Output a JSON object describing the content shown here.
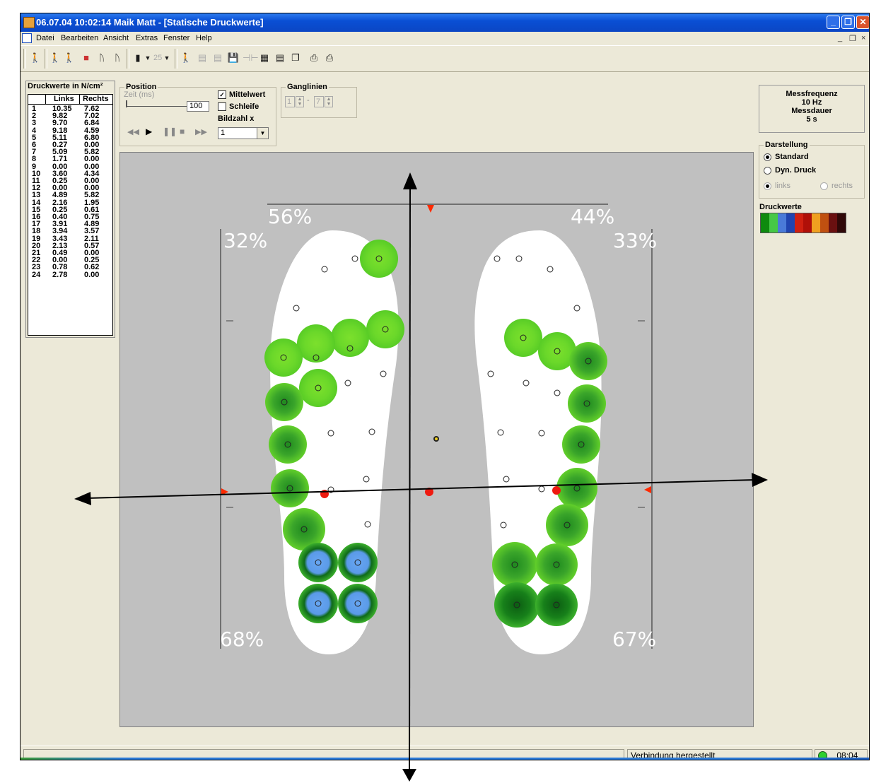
{
  "window": {
    "title": "06.07.04 10:02:14 Maik Matt  - [Statische Druckwerte]",
    "buttons": {
      "minimize": "_",
      "restore": "❐",
      "close": "✕"
    }
  },
  "menu": {
    "items": [
      "Datei",
      "Bearbeiten",
      "Ansicht",
      "Extras",
      "Fenster",
      "Help"
    ],
    "mdi_buttons": [
      "_",
      "❐",
      "×"
    ]
  },
  "toolbar": {
    "zoom_value": "25"
  },
  "pressure_table": {
    "title": "Druckwerte in N/cm²",
    "col_left": "Links",
    "col_right": "Rechts",
    "rows": [
      {
        "n": "1",
        "l": "10.35",
        "r": "7.62"
      },
      {
        "n": "2",
        "l": "9.82",
        "r": "7.02"
      },
      {
        "n": "3",
        "l": "9.70",
        "r": "6.84"
      },
      {
        "n": "4",
        "l": "9.18",
        "r": "4.59"
      },
      {
        "n": "5",
        "l": "5.11",
        "r": "6.80"
      },
      {
        "n": "6",
        "l": "0.27",
        "r": "0.00"
      },
      {
        "n": "7",
        "l": "5.09",
        "r": "5.82"
      },
      {
        "n": "8",
        "l": "1.71",
        "r": "0.00"
      },
      {
        "n": "9",
        "l": "0.00",
        "r": "0.00"
      },
      {
        "n": "10",
        "l": "3.60",
        "r": "4.34"
      },
      {
        "n": "11",
        "l": "0.25",
        "r": "0.00"
      },
      {
        "n": "12",
        "l": "0.00",
        "r": "0.00"
      },
      {
        "n": "13",
        "l": "4.89",
        "r": "5.82"
      },
      {
        "n": "14",
        "l": "2.16",
        "r": "1.95"
      },
      {
        "n": "15",
        "l": "0.25",
        "r": "0.61"
      },
      {
        "n": "16",
        "l": "0.40",
        "r": "0.75"
      },
      {
        "n": "17",
        "l": "3.91",
        "r": "4.89"
      },
      {
        "n": "18",
        "l": "3.94",
        "r": "3.57"
      },
      {
        "n": "19",
        "l": "3.43",
        "r": "2.11"
      },
      {
        "n": "20",
        "l": "2.13",
        "r": "0.57"
      },
      {
        "n": "21",
        "l": "0.49",
        "r": "0.00"
      },
      {
        "n": "22",
        "l": "0.00",
        "r": "0.25"
      },
      {
        "n": "23",
        "l": "0.78",
        "r": "0.62"
      },
      {
        "n": "24",
        "l": "2.78",
        "r": "0.00"
      }
    ]
  },
  "position": {
    "title": "Position",
    "zeit_label": "Zeit (ms)",
    "zeit_value": "100",
    "mittelwert_label": "Mittelwert",
    "mittelwert_checked": true,
    "schleife_label": "Schleife",
    "schleife_checked": false,
    "bildzahl_label": "Bildzahl x",
    "bildzahl_value": "1"
  },
  "ganglinien": {
    "title": "Ganglinien",
    "from": "1",
    "to": "7",
    "dash": "-"
  },
  "measurement": {
    "freq_label": "Messfrequenz",
    "freq_value": "10 Hz",
    "dur_label": "Messdauer",
    "dur_value": "5 s"
  },
  "darstellung": {
    "title": "Darstellung",
    "options": [
      "Standard",
      "Dyn. Druck"
    ],
    "selected": "Standard",
    "side_options": [
      "links",
      "rechts"
    ]
  },
  "legend": {
    "title": "Druckwerte",
    "colors": [
      "#0e8a0e",
      "#46c846",
      "#4a7ad8",
      "#2044b0",
      "#d02010",
      "#b01008",
      "#f0a020",
      "#c05010",
      "#6a1010",
      "#300808"
    ]
  },
  "percentages": {
    "top_left": "56%",
    "top_right": "44%",
    "left_top": "32%",
    "right_top": "33%",
    "left_bottom": "68%",
    "right_bottom": "67%"
  },
  "status": {
    "text": "Verbindung hergestellt",
    "time": "08:04"
  }
}
